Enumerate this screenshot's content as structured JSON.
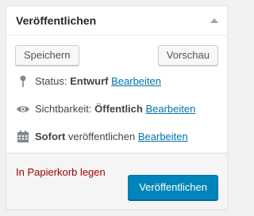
{
  "metabox": {
    "title": "Veröffentlichen"
  },
  "minor_actions": {
    "save_label": "Speichern",
    "preview_label": "Vorschau"
  },
  "status": {
    "label": "Status:",
    "value": "Entwurf",
    "edit_label": "Bearbeiten",
    "icon": "pin-icon"
  },
  "visibility": {
    "label": "Sichtbarkeit:",
    "value": "Öffentlich",
    "edit_label": "Bearbeiten",
    "icon": "eye-icon"
  },
  "schedule": {
    "value": "Sofort",
    "label": "veröffentlichen",
    "edit_label": "Bearbeiten",
    "icon": "calendar-icon"
  },
  "major_actions": {
    "delete_label": "In Papierkorb legen",
    "publish_label": "Veröffentlichen"
  },
  "colors": {
    "link": "#0073aa",
    "delete": "#a00000",
    "primary_button": "#0085ba",
    "text": "#444444"
  }
}
